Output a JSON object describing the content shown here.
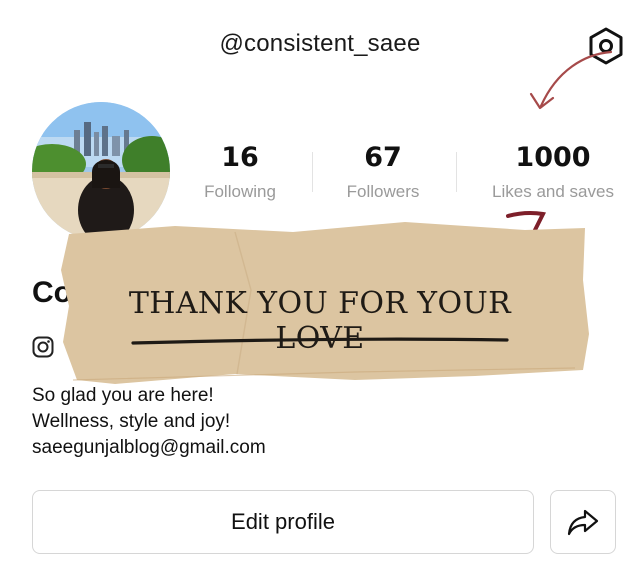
{
  "header": {
    "handle": "@consistent_saee",
    "settings_icon": "hexagon-settings-icon"
  },
  "profile": {
    "avatar_icon": "profile-photo",
    "name_visible": "Co",
    "stats": [
      {
        "value": "16",
        "label": "Following"
      },
      {
        "value": "67",
        "label": "Followers"
      },
      {
        "value": "1000",
        "label": "Likes and saves"
      }
    ],
    "link_icon": "instagram-icon",
    "bio_lines": [
      "So glad you are here!",
      "Wellness, style and joy!",
      "saeegunjalblog@gmail.com"
    ]
  },
  "overlay": {
    "tape_text": "THANK YOU FOR YOUR LOVE",
    "tape_color": "#dcc5a1"
  },
  "actions": {
    "edit_profile": "Edit profile",
    "share_icon": "share-arrow-icon"
  },
  "colors": {
    "doodle": "#a64a4a",
    "stat_label": "#9a9a9a",
    "border": "#d6d6d6"
  }
}
